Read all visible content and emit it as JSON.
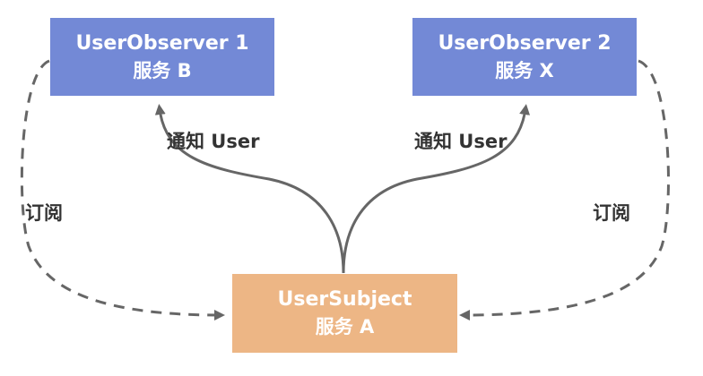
{
  "colors": {
    "observer_fill": "#7389D6",
    "subject_fill": "#EDB685",
    "edge_stroke": "#666666",
    "label_text": "#333333",
    "node_text": "#FFFFFF"
  },
  "nodes": {
    "observer1": {
      "title": "UserObserver 1",
      "subtitle": "服务 B"
    },
    "observer2": {
      "title": "UserObserver 2",
      "subtitle": "服务 X"
    },
    "subject": {
      "title": "UserSubject",
      "subtitle": "服务 A"
    }
  },
  "edges": {
    "notify_left": {
      "label": "通知 User",
      "style": "solid",
      "from": "subject",
      "to": "observer1"
    },
    "notify_right": {
      "label": "通知 User",
      "style": "solid",
      "from": "subject",
      "to": "observer2"
    },
    "subscribe_left": {
      "label": "订阅",
      "style": "dashed",
      "from": "observer1",
      "to": "subject"
    },
    "subscribe_right": {
      "label": "订阅",
      "style": "dashed",
      "from": "observer2",
      "to": "subject"
    }
  }
}
